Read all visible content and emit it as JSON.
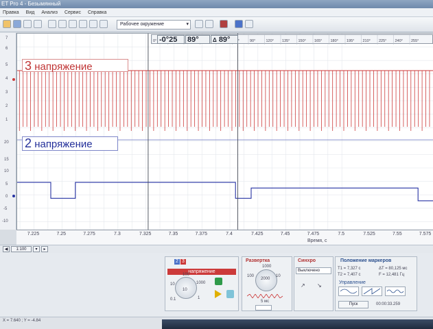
{
  "window": {
    "title": "ET Pro 4 - Безымянный"
  },
  "menu": {
    "items": [
      "Правка",
      "Вид",
      "Анализ",
      "Сервис",
      "Справка"
    ]
  },
  "toolbar": {
    "workspace": "Рабочее окружение"
  },
  "markers": {
    "angle_start": "-0°25",
    "angle_m1": "89°",
    "delta": "89°"
  },
  "angle_scale": [
    "0°",
    "15°",
    "30°",
    "45°",
    "60°",
    "75°",
    "90°",
    "120°",
    "135°",
    "150°",
    "165°",
    "180°",
    "195°",
    "210°",
    "225°",
    "240°",
    "255°"
  ],
  "channels": {
    "ch3": {
      "number": "3",
      "name": "напряжение",
      "color": "#cc3a3a"
    },
    "ch2": {
      "number": "2",
      "name": "напряжение",
      "color": "#2632a3"
    }
  },
  "y_axis_ticks": [
    "7",
    "6",
    "5",
    "4",
    "3",
    "2",
    "1",
    "20",
    "15",
    "10",
    "5",
    "0",
    "-5",
    "-10"
  ],
  "x_axis": {
    "ticks": [
      "7.225",
      "7.25",
      "7.275",
      "7.3",
      "7.325",
      "7.35",
      "7.375",
      "7.4",
      "7.425",
      "7.45",
      "7.475",
      "7.5",
      "7.525",
      "7.55",
      "7.575"
    ],
    "label": "Время, с"
  },
  "scrollbar": {
    "zoom": "1:100"
  },
  "panels": {
    "channel": {
      "title": "напряжение",
      "knob_labels": [
        "100",
        "1000",
        "10",
        "1",
        "0.1",
        "10"
      ]
    },
    "sweep": {
      "title": "Развертка",
      "knob_labels": [
        "1000",
        "100",
        "2000",
        "10"
      ],
      "value": "5 мс"
    },
    "sync": {
      "title": "Синхро",
      "mode": "Выключено"
    },
    "markers": {
      "title": "Положение маркеров",
      "t1": "T1 = 7,327 с",
      "t2": "T2 = 7,407 с",
      "dt": "ΔT = 80,125 мс",
      "f": "F = 12,481 Гц",
      "control": "Управление",
      "start": "Пуск",
      "timecode": "00:00:33.259"
    }
  },
  "status": {
    "text": "X = 7.640 ; Y = -4.84"
  },
  "colors": {
    "trace_ch3": "#cc3a3a",
    "trace_ch2": "#2632a3",
    "marker_line": "#444a55"
  },
  "chart_data": {
    "type": "line",
    "xlabel": "Время, с",
    "xlim": [
      7.21,
      7.582
    ],
    "series": [
      {
        "name": "3 напряжение",
        "ylim": [
          0,
          7
        ],
        "note_steps": "impulse spikes",
        "x": [
          7.21,
          7.582
        ],
        "y": [
          5.6,
          5.6
        ]
      },
      {
        "name": "2 напряжение",
        "ylim": [
          -10,
          20
        ],
        "x": [
          7.21,
          7.24,
          7.24,
          7.262,
          7.262,
          7.405,
          7.405,
          7.419,
          7.419,
          7.568,
          7.568,
          7.582
        ],
        "y": [
          4.6,
          4.6,
          -0.5,
          -0.5,
          4.6,
          4.6,
          -0.5,
          -0.5,
          2.8,
          2.8,
          -1.3,
          -1.3
        ]
      }
    ]
  }
}
